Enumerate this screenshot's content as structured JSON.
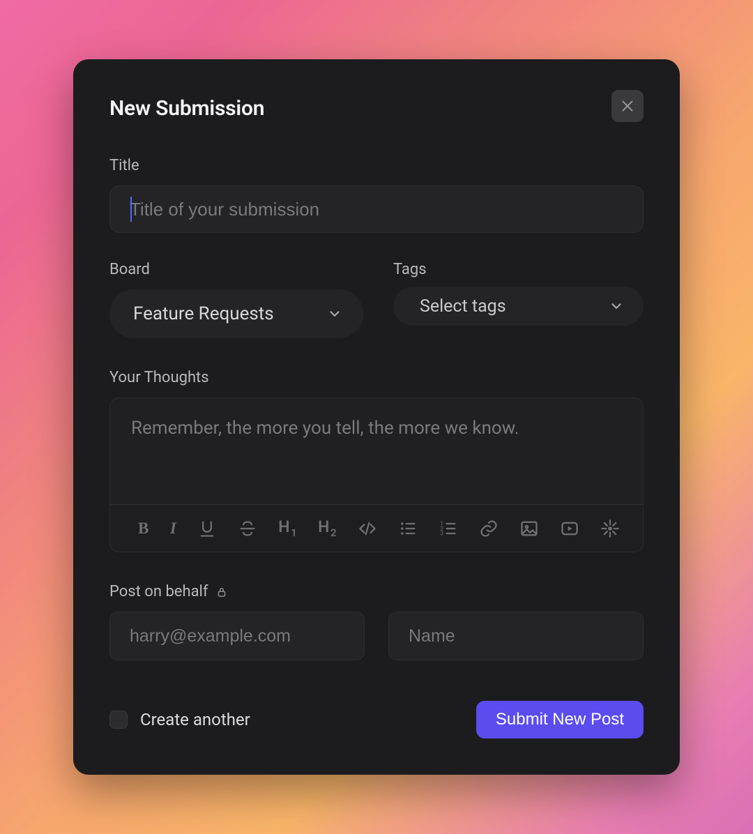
{
  "modal": {
    "title": "New Submission"
  },
  "fields": {
    "title_label": "Title",
    "title_placeholder": "Title of your submission",
    "board_label": "Board",
    "board_value": "Feature Requests",
    "tags_label": "Tags",
    "tags_placeholder": "Select tags",
    "thoughts_label": "Your Thoughts",
    "thoughts_placeholder": "Remember, the more you tell, the more we know.",
    "behalf_label": "Post on behalf",
    "behalf_email_placeholder": "harry@example.com",
    "behalf_name_placeholder": "Name"
  },
  "toolbar": {
    "bold": "B",
    "italic": "I",
    "h1": "H",
    "h1_sub": "1",
    "h2": "H",
    "h2_sub": "2"
  },
  "footer": {
    "create_another_label": "Create another",
    "submit_label": "Submit New Post"
  }
}
